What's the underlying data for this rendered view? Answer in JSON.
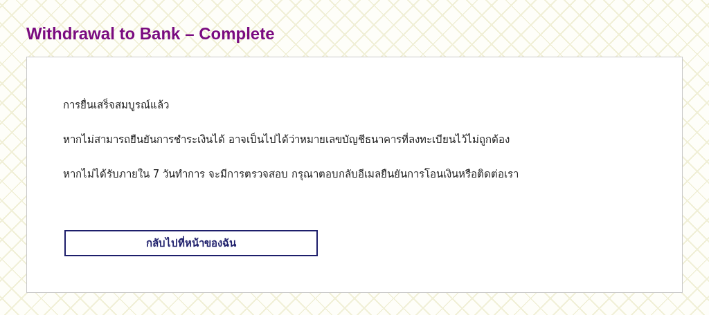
{
  "page": {
    "title": "Withdrawal to Bank – Complete"
  },
  "messages": [
    "การยื่นเสร็จสมบูรณ์แล้ว",
    "หากไม่สามารถยืนยันการชำระเงินได้ อาจเป็นไปได้ว่าหมายเลขบัญชีธนาคารที่ลงทะเบียนไว้ไม่ถูกต้อง",
    "หากไม่ได้รับภายใน 7 วันทำการ จะมีการตรวจสอบ กรุณาตอบกลับอีเมลยืนยันการโอนเงินหรือติดต่อเรา"
  ],
  "button": {
    "label": "กลับไปที่หน้าของฉัน"
  }
}
